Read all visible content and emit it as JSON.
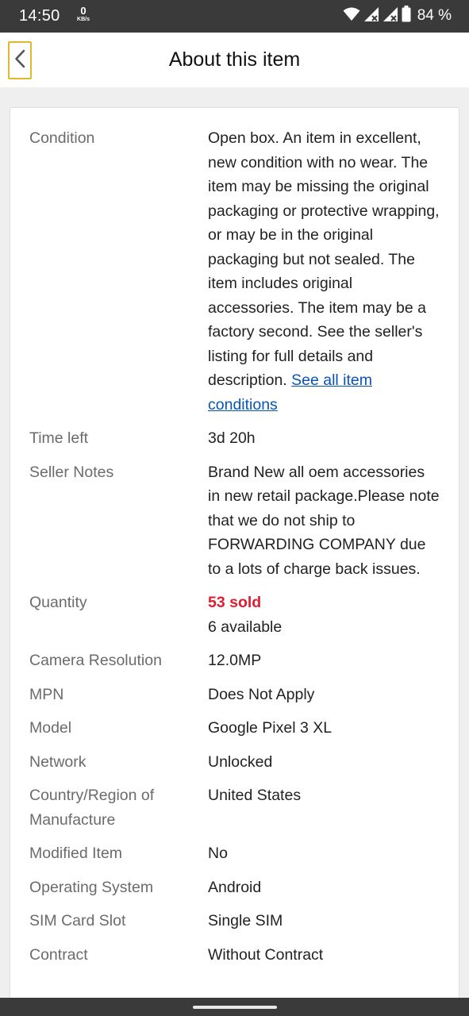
{
  "status_bar": {
    "time": "14:50",
    "net_speed_value": "0",
    "net_speed_unit": "KB/s",
    "battery_text": "84 %"
  },
  "header": {
    "title": "About this item"
  },
  "colors": {
    "sold_red": "#dd1e31",
    "link_blue": "#0654ba",
    "back_focus": "#e2b92c"
  },
  "specs": {
    "condition": {
      "label": "Condition",
      "text": "Open box. An item in excellent, new condition with no wear. The item may be missing the original packaging or protective wrapping, or may be in the original packaging but not sealed. The item includes original accessories. The item may be a factory second. See the seller's listing for full details and description.",
      "link": "See all item conditions"
    },
    "time_left": {
      "label": "Time left",
      "value": "3d 20h"
    },
    "seller_notes": {
      "label": "Seller Notes",
      "value": "Brand New all oem accessories in new retail package.Please note that we do not ship to FORWARDING COMPANY due to a lots of charge back issues."
    },
    "quantity": {
      "label": "Quantity",
      "sold": "53 sold",
      "available": "6 available"
    },
    "camera_resolution": {
      "label": "Camera Resolution",
      "value": "12.0MP"
    },
    "mpn": {
      "label": "MPN",
      "value": "Does Not Apply"
    },
    "model": {
      "label": "Model",
      "value": "Google Pixel 3 XL"
    },
    "network": {
      "label": "Network",
      "value": "Unlocked"
    },
    "country": {
      "label": "Country/Region of Manufacture",
      "value": "United States"
    },
    "modified_item": {
      "label": "Modified Item",
      "value": "No"
    },
    "operating_system": {
      "label": "Operating System",
      "value": "Android"
    },
    "sim_card_slot": {
      "label": "SIM Card Slot",
      "value": "Single SIM"
    },
    "contract": {
      "label": "Contract",
      "value": "Without Contract"
    }
  }
}
